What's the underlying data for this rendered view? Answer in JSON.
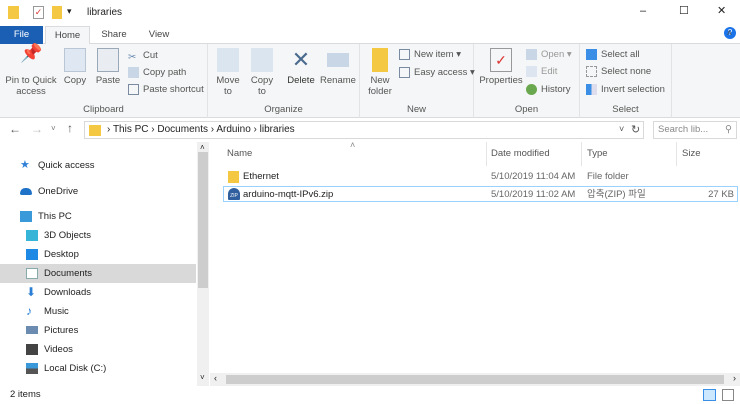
{
  "window": {
    "title": "libraries",
    "minimize": "–",
    "maximize": "☐",
    "close": "✕"
  },
  "tabs": [
    {
      "label": "File"
    },
    {
      "label": "Home"
    },
    {
      "label": "Share"
    },
    {
      "label": "View"
    }
  ],
  "ribbon": {
    "clipboard": {
      "label": "Clipboard",
      "pin": "Pin to Quick access",
      "copy": "Copy",
      "paste": "Paste",
      "cut": "Cut",
      "copy_path": "Copy path",
      "paste_shortcut": "Paste shortcut"
    },
    "organize": {
      "label": "Organize",
      "move_to": "Move to",
      "copy_to": "Copy to",
      "delete": "Delete",
      "rename": "Rename"
    },
    "new": {
      "label": "New",
      "new_folder": "New folder",
      "new_item": "New item ▾",
      "easy_access": "Easy access ▾"
    },
    "open": {
      "label": "Open",
      "properties": "Properties",
      "open": "Open ▾",
      "edit": "Edit",
      "history": "History"
    },
    "select": {
      "label": "Select",
      "select_all": "Select all",
      "select_none": "Select none",
      "invert": "Invert selection"
    }
  },
  "address": {
    "breadcrumb": [
      "This PC",
      "Documents",
      "Arduino",
      "libraries"
    ],
    "search_placeholder": "Search lib..."
  },
  "nav": [
    {
      "label": "Quick access",
      "color": "#2f7fd6"
    },
    {
      "label": "OneDrive",
      "color": "#1e73c8"
    },
    {
      "label": "This PC",
      "color": "#3a9ad9"
    },
    {
      "label": "3D Objects",
      "color": "#36b5d8"
    },
    {
      "label": "Desktop",
      "color": "#1e88e5"
    },
    {
      "label": "Documents",
      "color": "#8aa"
    },
    {
      "label": "Downloads",
      "color": "#2a7fd4"
    },
    {
      "label": "Music",
      "color": "#2a7fd4"
    },
    {
      "label": "Pictures",
      "color": "#6b8bb0"
    },
    {
      "label": "Videos",
      "color": "#444"
    },
    {
      "label": "Local Disk (C:)",
      "color": "#3a9ad9"
    }
  ],
  "columns": {
    "name": "Name",
    "date": "Date modified",
    "type": "Type",
    "size": "Size"
  },
  "files": [
    {
      "name": "Ethernet",
      "date": "5/10/2019 11:04 AM",
      "type": "File folder",
      "size": ""
    },
    {
      "name": "arduino-mqtt-IPv6.zip",
      "date": "5/10/2019 11:02 AM",
      "type": "압축(ZIP) 파일",
      "size": "27 KB"
    }
  ],
  "status": {
    "count": "2 items"
  }
}
